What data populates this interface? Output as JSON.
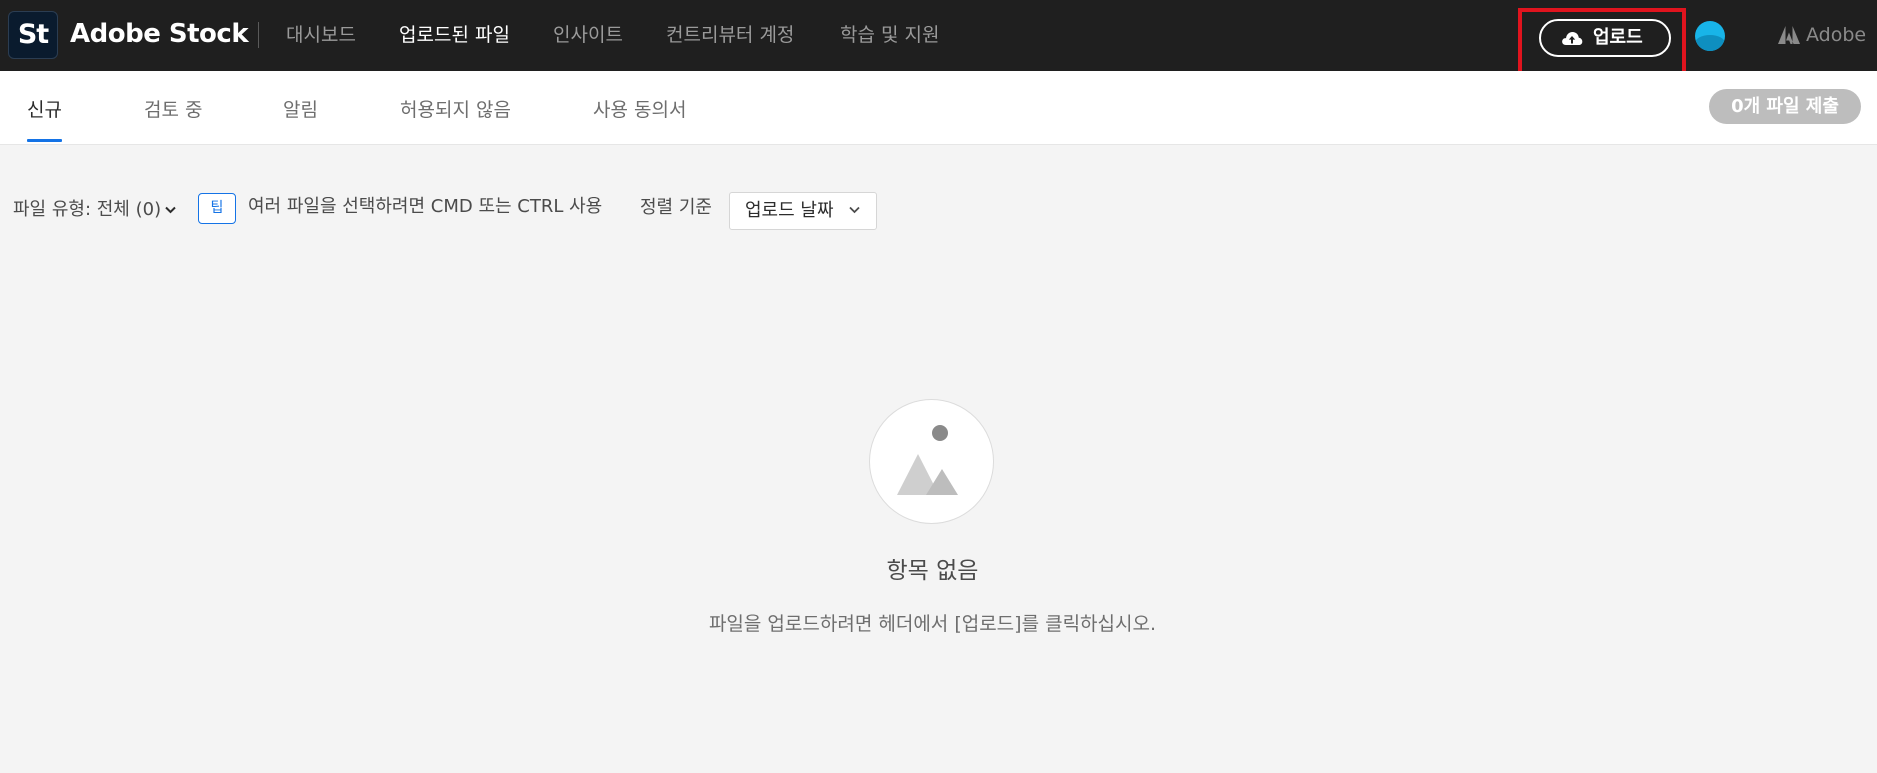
{
  "header": {
    "logo_text": "St",
    "brand": "Adobe Stock",
    "nav": [
      {
        "label": "대시보드"
      },
      {
        "label": "업로드된 파일"
      },
      {
        "label": "인사이트"
      },
      {
        "label": "컨트리뷰터 계정"
      },
      {
        "label": "학습 및 지원"
      }
    ],
    "upload_label": "업로드",
    "adobe_label": "Adobe"
  },
  "tabs": {
    "items": [
      {
        "label": "신규"
      },
      {
        "label": "검토 중"
      },
      {
        "label": "알림"
      },
      {
        "label": "허용되지 않음"
      },
      {
        "label": "사용 동의서"
      }
    ],
    "submit_label": "0개 파일 제출"
  },
  "filters": {
    "file_type_label": "파일 유형: 전체 (0)",
    "tip_badge": "팁",
    "tip_text": "여러 파일을 선택하려면 CMD 또는 CTRL 사용",
    "sort_label": "정렬 기준",
    "sort_value": "업로드 날짜"
  },
  "empty": {
    "title": "항목 없음",
    "description": "파일을 업로드하려면 헤더에서 [업로드]를 클릭하십시오."
  },
  "colors": {
    "header_bg": "#1f1f1f",
    "accent_blue": "#1473e6",
    "highlight_red": "#e0141e",
    "avatar": "#18b4e8"
  }
}
